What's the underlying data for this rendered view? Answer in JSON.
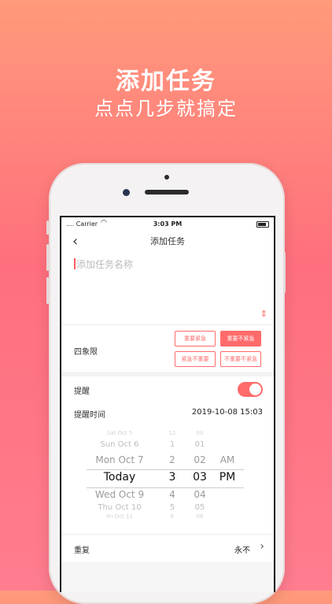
{
  "hero": {
    "title": "添加任务",
    "subtitle": "点点几步就搞定"
  },
  "status_bar": {
    "carrier": ".... Carrier",
    "time": "3:03 PM"
  },
  "nav": {
    "back_icon": "chevron-left-icon",
    "title": "添加任务"
  },
  "task_name": {
    "placeholder": "添加任务名称"
  },
  "quadrant": {
    "label": "四象限",
    "options": [
      {
        "label": "重要紧急",
        "selected": false
      },
      {
        "label": "重要不紧急",
        "selected": true
      },
      {
        "label": "紧急不重要",
        "selected": false
      },
      {
        "label": "不重要不紧急",
        "selected": false
      }
    ]
  },
  "reminder": {
    "label": "提醒",
    "enabled": true
  },
  "reminder_time": {
    "label": "提醒时间",
    "value": "2019-10-08 15:03"
  },
  "picker": {
    "dates": [
      "Sat Oct 5",
      "Sun Oct 6",
      "Mon Oct 7",
      "Today",
      "Wed Oct 9",
      "Thu Oct 10",
      "Fri Oct 11"
    ],
    "hours": [
      "12",
      "1",
      "2",
      "3",
      "4",
      "5",
      "6"
    ],
    "minutes": [
      "00",
      "01",
      "02",
      "03",
      "04",
      "05",
      "06"
    ],
    "ampm": [
      "AM",
      "PM"
    ]
  },
  "repeat": {
    "label": "重复",
    "value": "永不"
  },
  "colors": {
    "accent": "#ff6b6b"
  }
}
